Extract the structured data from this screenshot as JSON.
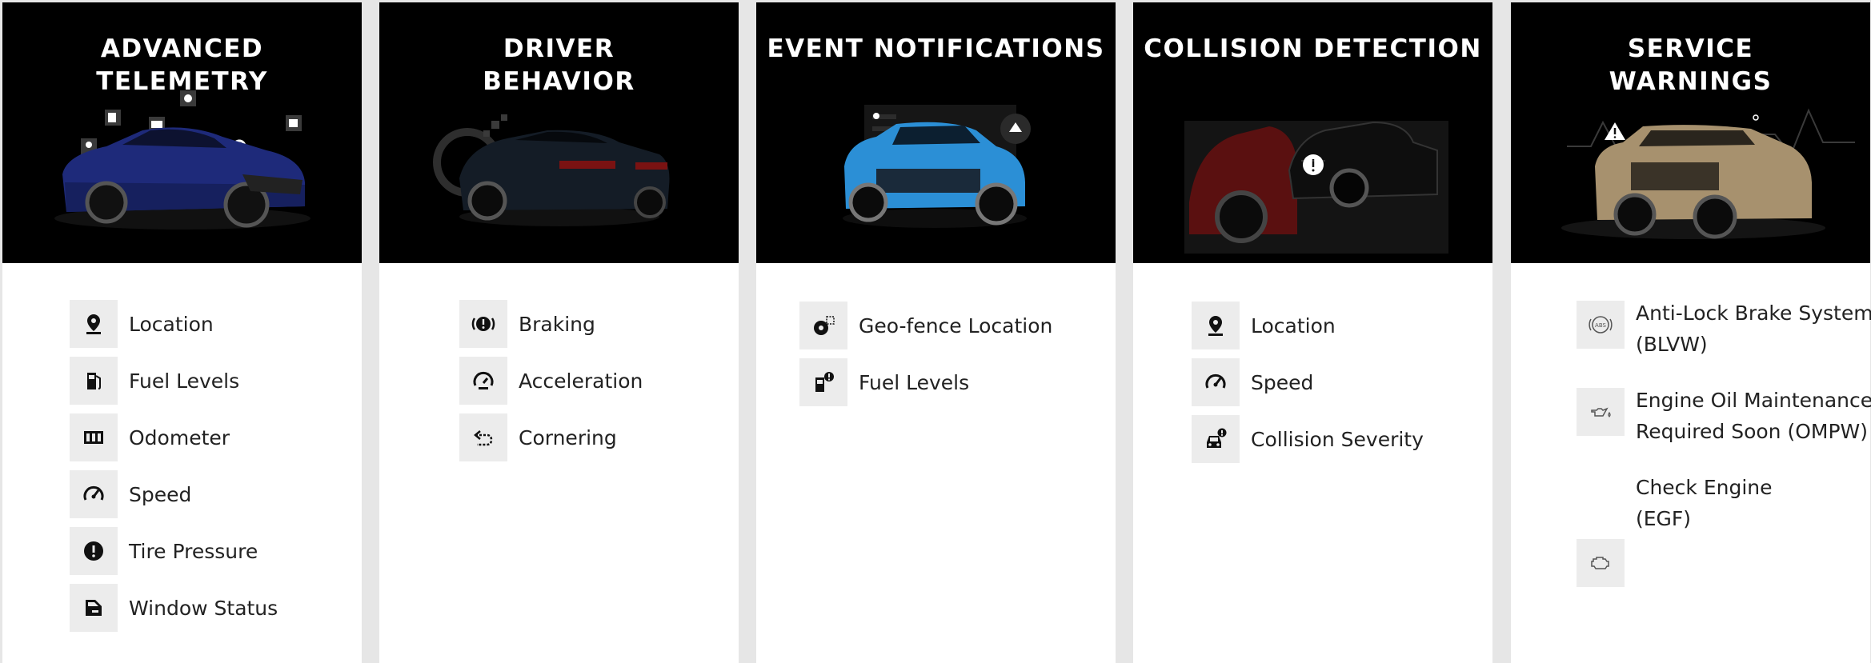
{
  "cards": [
    {
      "title": "ADVANCED TELEMETRY",
      "features": [
        {
          "label": "Location",
          "icon": "location-pin-icon"
        },
        {
          "label": "Fuel Levels",
          "icon": "fuel-pump-icon"
        },
        {
          "label": "Odometer",
          "icon": "odometer-icon"
        },
        {
          "label": "Speed",
          "icon": "speedometer-icon"
        },
        {
          "label": "Tire Pressure",
          "icon": "tire-pressure-icon"
        },
        {
          "label": "Window Status",
          "icon": "window-icon"
        }
      ]
    },
    {
      "title_lines": [
        "DRIVER",
        "BEHAVIOR"
      ],
      "features": [
        {
          "label": "Braking",
          "icon": "braking-icon"
        },
        {
          "label": "Acceleration",
          "icon": "acceleration-gauge-icon"
        },
        {
          "label": "Cornering",
          "icon": "cornering-arrow-icon"
        }
      ]
    },
    {
      "title": "EVENT NOTIFICATIONS",
      "features": [
        {
          "label": "Geo-fence Location",
          "icon": "geo-fence-icon"
        },
        {
          "label": "Fuel Levels",
          "icon": "fuel-alert-icon"
        }
      ]
    },
    {
      "title": "COLLISION DETECTION",
      "features": [
        {
          "label": "Location",
          "icon": "location-pin-icon"
        },
        {
          "label": "Speed",
          "icon": "speedometer-icon"
        },
        {
          "label": "Collision Severity",
          "icon": "collision-car-icon"
        }
      ]
    },
    {
      "title_lines": [
        "SERVICE",
        "WARNINGS"
      ],
      "features": [
        {
          "lines": [
            "Anti-Lock Brake System",
            "(BLVW)"
          ],
          "icon": "abs-icon"
        },
        {
          "lines": [
            "Engine Oil Maintenance",
            "Required Soon (OMPW)"
          ],
          "icon": "oil-can-icon"
        },
        {
          "lines": [
            "Check Engine",
            "(EGF)"
          ],
          "icon": "check-engine-icon"
        }
      ]
    }
  ],
  "colors": {
    "header_bg": "#000000",
    "icon_tile": "#ececec",
    "text": "#222222",
    "page_bg": "#e6e6e6"
  }
}
